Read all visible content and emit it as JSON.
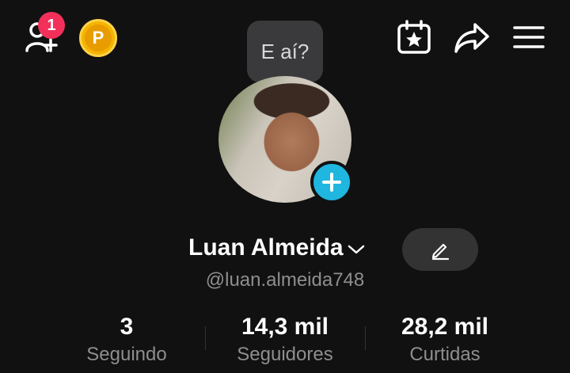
{
  "header": {
    "notification_count": "1",
    "coin_label": "P",
    "icons": [
      "add-friend-icon",
      "coin-icon",
      "calendar-star-icon",
      "share-icon",
      "menu-icon"
    ]
  },
  "profile": {
    "status_bubble": "E aí?",
    "name": "Luan Almeida",
    "handle": "@luan.almeida748"
  },
  "stats": [
    {
      "value": "3",
      "label": "Seguindo"
    },
    {
      "value": "14,3 mil",
      "label": "Seguidores"
    },
    {
      "value": "28,2 mil",
      "label": "Curtidas"
    }
  ],
  "colors": {
    "background": "#111111",
    "badge": "#f2305a",
    "coin": "#f4b400",
    "add_button": "#1fb6e0",
    "muted_text": "#8e8e8e"
  }
}
